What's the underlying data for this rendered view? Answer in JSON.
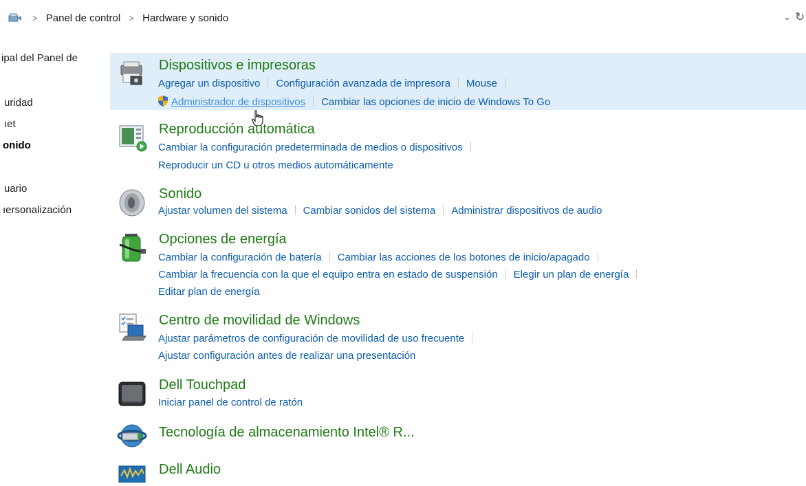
{
  "breadcrumb": {
    "items": [
      "Panel de control",
      "Hardware y sonido"
    ],
    "separator": ">"
  },
  "leftnav": {
    "items": [
      {
        "label": "ipal del Panel de",
        "bold": false
      },
      {
        "label": "uridad",
        "bold": false
      },
      {
        "label": "ıet",
        "bold": false
      },
      {
        "label": "onido",
        "bold": true
      },
      {
        "label": "uario",
        "bold": false
      },
      {
        "label": "ıersonalización",
        "bold": false
      }
    ]
  },
  "categories": [
    {
      "title": "Dispositivos e impresoras",
      "icon": "printer-icon",
      "lines": [
        [
          "Agregar un dispositivo",
          "Configuración avanzada de impresora",
          "Mouse"
        ],
        [
          "Administrador de dispositivos",
          "Cambiar las opciones de inicio de Windows To Go"
        ]
      ]
    },
    {
      "title": "Reproducción automática",
      "icon": "autoplay-icon",
      "lines": [
        [
          "Cambiar la configuración predeterminada de medios o dispositivos"
        ],
        [
          "Reproducir un CD u otros medios automáticamente"
        ]
      ]
    },
    {
      "title": "Sonido",
      "icon": "speaker-icon",
      "lines": [
        [
          "Ajustar volumen del sistema",
          "Cambiar sonidos del sistema",
          "Administrar dispositivos de audio"
        ]
      ]
    },
    {
      "title": "Opciones de energía",
      "icon": "battery-icon",
      "lines": [
        [
          "Cambiar la configuración de batería",
          "Cambiar las acciones de los botones de inicio/apagado"
        ],
        [
          "Cambiar la frecuencia con la que el equipo entra en estado de suspensión",
          "Elegir un plan de energía"
        ],
        [
          "Editar plan de energía"
        ]
      ]
    },
    {
      "title": "Centro de movilidad de Windows",
      "icon": "mobility-icon",
      "lines": [
        [
          "Ajustar parámetros de configuración de movilidad de uso frecuente"
        ],
        [
          "Ajustar configuración antes de realizar una presentación"
        ]
      ]
    },
    {
      "title": "Dell Touchpad",
      "icon": "touchpad-icon",
      "lines": [
        [
          "Iniciar panel de control de ratón"
        ]
      ]
    },
    {
      "title": "Tecnología de almacenamiento Intel® R...",
      "icon": "intel-storage-icon",
      "lines": []
    },
    {
      "title": "Dell Audio",
      "icon": "dell-audio-icon",
      "lines": []
    }
  ],
  "colors": {
    "link": "#0b5cb0",
    "title": "#1e7a14",
    "selected_bg": "#e0eef9"
  }
}
